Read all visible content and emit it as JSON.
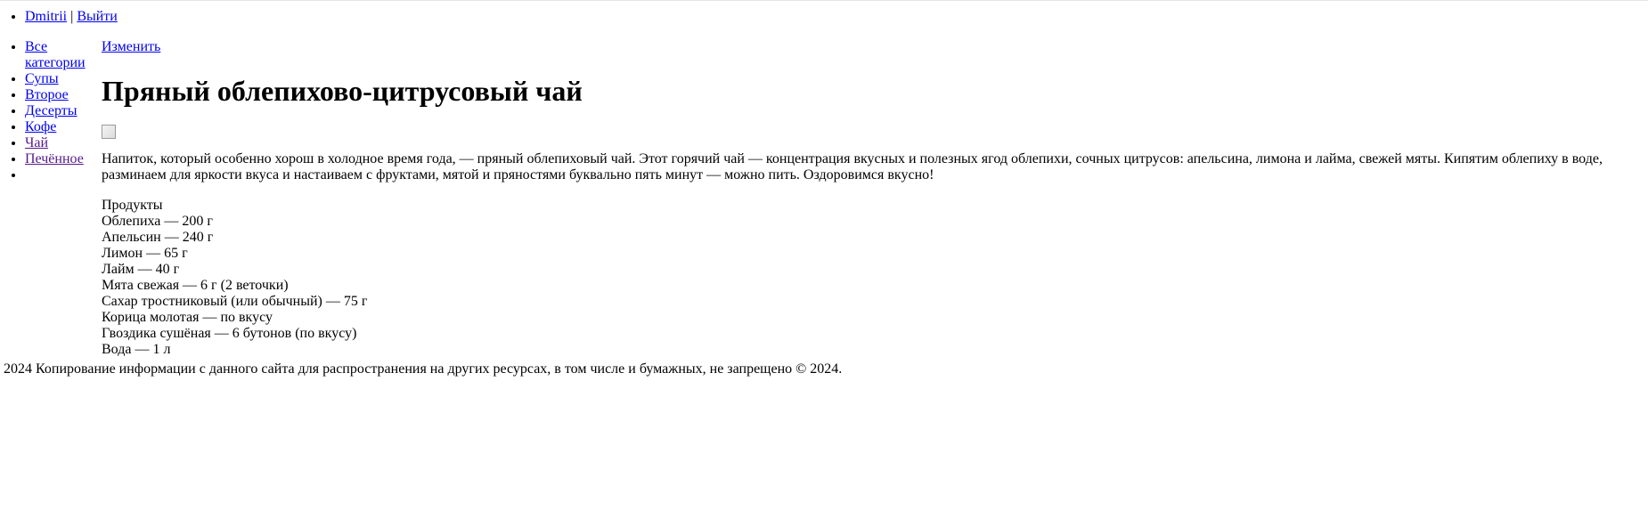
{
  "header": {
    "user_link": "Dmitrii",
    "separator": "|",
    "logout_link": "Выйти"
  },
  "sidebar": {
    "items": [
      {
        "label": "Все категории"
      },
      {
        "label": "Супы"
      },
      {
        "label": "Второе"
      },
      {
        "label": "Десерты"
      },
      {
        "label": "Кофе"
      },
      {
        "label": "Чай"
      },
      {
        "label": "Печённое"
      },
      {
        "label": ""
      }
    ]
  },
  "main": {
    "edit_link": "Изменить",
    "title": "Пряный облепихово-цитрусовый чай",
    "description": "Напиток, который особенно хорош в холодное время года, — пряный облепиховый чай. Этот горячий чай — концентрация вкусных и полезных ягод облепихи, сочных цитрусов: апельсина, лимона и лайма, свежей мяты. Кипятим облепиху в воде, разминаем для яркости вкуса и настаиваем с фруктами, мятой и пряностями буквально пять минут — можно пить. Оздоровимся вкусно!",
    "products_title": "Продукты",
    "products": [
      "Облепиха — 200 г",
      "Апельсин — 240 г",
      "Лимон — 65 г",
      "Лайм — 40 г",
      "Мята свежая — 6 г (2 веточки)",
      "Сахар тростниковый (или обычный) — 75 г",
      "Корица молотая — по вкусу",
      "Гвоздика сушёная — 6 бутонов (по вкусу)",
      "Вода — 1 л"
    ]
  },
  "footer": {
    "text": "2024 Копирование информации с данного сайта для распространения на других ресурсах, в том числе и бумажных, не запрещено © 2024."
  },
  "colors": {
    "link": "#0000ee",
    "visited_link": "#551a8b",
    "text": "#000000",
    "background": "#ffffff"
  }
}
